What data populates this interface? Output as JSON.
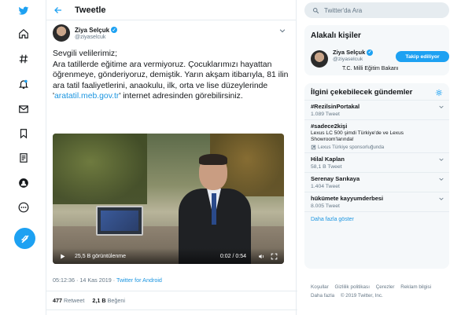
{
  "colors": {
    "accent": "#1da1f2",
    "link": "#1b95e0",
    "muted": "#657786",
    "border": "#e6ecf0"
  },
  "nav": {
    "items": [
      {
        "name": "twitter-logo-icon",
        "icon": "bird"
      },
      {
        "name": "home-icon",
        "icon": "home"
      },
      {
        "name": "explore-icon",
        "icon": "hash"
      },
      {
        "name": "notifications-icon",
        "icon": "bell"
      },
      {
        "name": "messages-icon",
        "icon": "envelope"
      },
      {
        "name": "bookmarks-icon",
        "icon": "bookmark"
      },
      {
        "name": "lists-icon",
        "icon": "list"
      },
      {
        "name": "profile-icon",
        "icon": "person"
      },
      {
        "name": "more-icon",
        "icon": "dots"
      }
    ]
  },
  "header": {
    "title": "Tweetle"
  },
  "tweet": {
    "author_name": "Ziya Selçuk",
    "author_handle": "@ziyaselcuk",
    "text_1": "Sevgili velilerimiz;",
    "text_2": "Ara tatillerde eğitime ara vermiyoruz. Çocuklarımızı hayattan öğrenmeye, gönderiyoruz, demiştik. Yarın akşam itibarıyla, 81 ilin ara tatil faaliyetlerini, anaokulu, ilk, orta ve lise düzeylerinde '",
    "link": "aratatil.meb.gov.tr",
    "text_3": "' internet adresinden görebilirsiniz.",
    "video_views": "25,5 B görüntülenme",
    "video_time": "0:02 / 0:54",
    "time": "05:12:36 · 14 Kas 2019 · ",
    "source": "Twitter for Android",
    "retweets_count": "477",
    "retweets_label": "Retweet",
    "likes_count": "2,1 B",
    "likes_label": "Beğeni"
  },
  "search": {
    "placeholder": "Twitter'da Ara"
  },
  "related": {
    "title": "Alakalı kişiler",
    "name": "Ziya Selçuk",
    "handle": "@ziyaselcuk",
    "bio": "T.C. Milli Eğitim Bakanı",
    "follow_label": "Takip ediliyor"
  },
  "trends": {
    "title": "İlgini çekebilecek gündemler",
    "items": [
      {
        "name": "#RezilsinPortakal",
        "sub": "1.089 Tweet"
      },
      {
        "name": "#sadece2kişi",
        "desc": "Lexus LC 500 şimdi Türkiye'de ve Lexus Showroom'larında!",
        "promoted": "Lexus Türkiye sponsorluğunda"
      },
      {
        "name": "Hilal Kaplan",
        "sub": "58,1 B Tweet"
      },
      {
        "name": "Serenay Sarıkaya",
        "sub": "1.404 Tweet"
      },
      {
        "name": "hükümete kayyumderbesi",
        "sub": "8.005 Tweet"
      }
    ],
    "more": "Daha fazla göster"
  },
  "footer": {
    "links": [
      "Koşullar",
      "Gizlilik politikası",
      "Çerezler",
      "Reklam bilgisi"
    ],
    "more": "Daha fazla",
    "copyright": "© 2019 Twitter, Inc."
  }
}
